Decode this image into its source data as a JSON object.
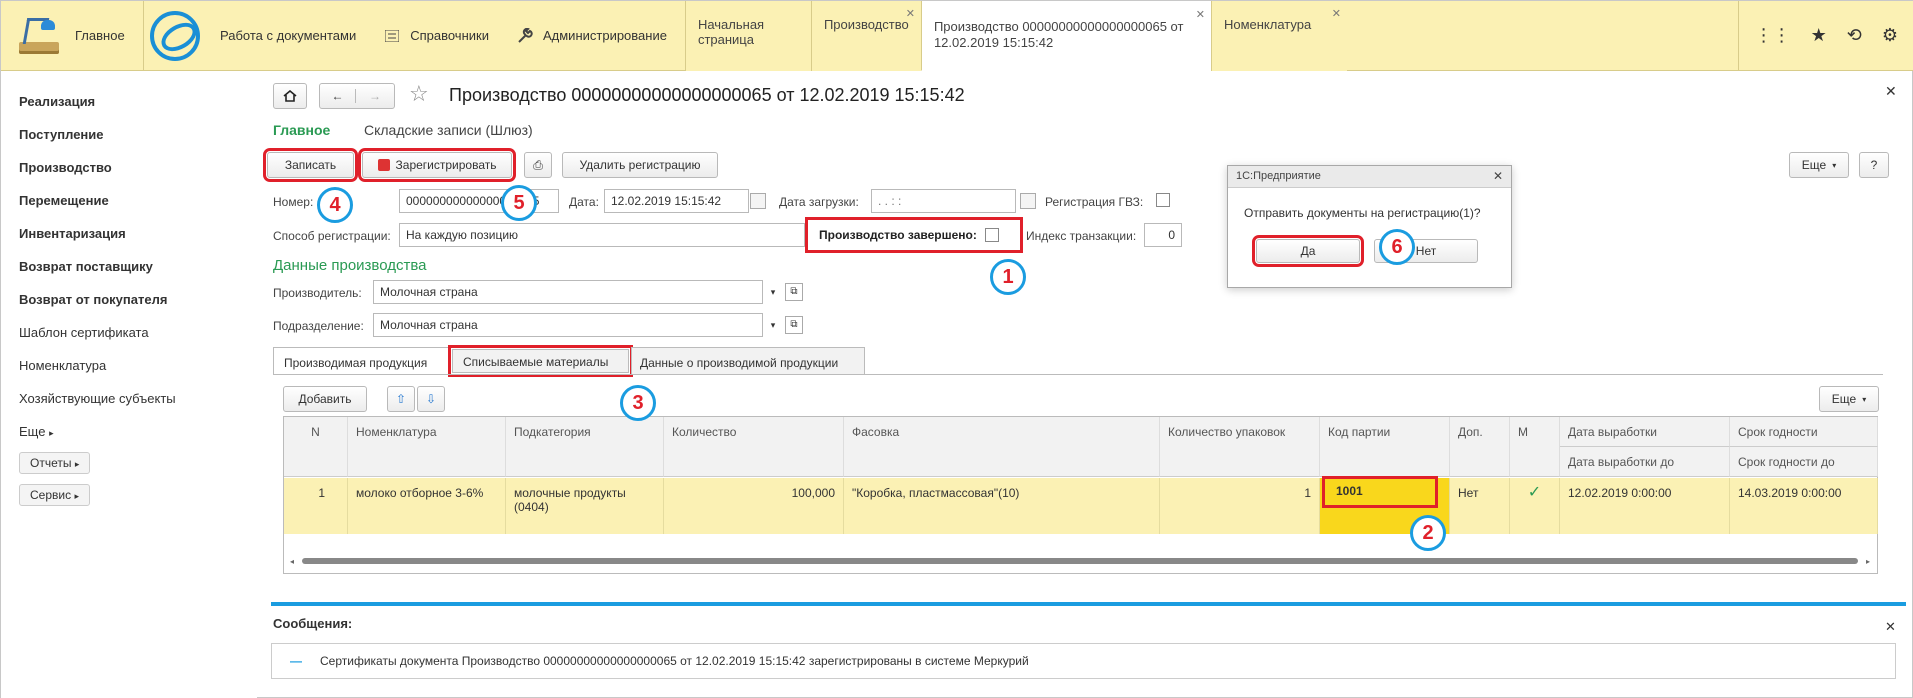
{
  "topbar": {
    "home_label": "Главное",
    "menu": [
      {
        "label": "Работа с документами"
      },
      {
        "label": "Справочники"
      },
      {
        "label": "Администрирование"
      }
    ],
    "tabs": [
      {
        "label": "Начальная страница"
      },
      {
        "label": "Производство"
      },
      {
        "label": "Производство 00000000000000000065 от",
        "label2": "12.02.2019 15:15:42"
      },
      {
        "label": "Номенклатура"
      }
    ]
  },
  "sidebar": {
    "items": [
      "Реализация",
      "Поступление",
      "Производство",
      "Перемещение",
      "Инвентаризация",
      "Возврат поставщику",
      "Возврат от покупателя",
      "Шаблон сертификата",
      "Номенклатура",
      "Хозяйствующие субъекты"
    ],
    "more": "Еще",
    "reports": "Отчеты",
    "service": "Сервис"
  },
  "doc": {
    "title": "Производство 00000000000000000065 от 12.02.2019 15:15:42",
    "nav_main": "Главное",
    "nav_wh": "Складские записи (Шлюз)",
    "btn_save": "Записать",
    "btn_register": "Зарегистрировать",
    "btn_delete_reg": "Удалить регистрацию",
    "btn_more": "Еще",
    "btn_help": "?",
    "number_label": "Номер:",
    "number_value": "00000000000000000065",
    "date_label": "Дата:",
    "date_value": "12.02.2019 15:15:42",
    "load_date_label": "Дата загрузки:",
    "load_date_value": " .  .       :  :",
    "gvz_label": "Регистрация ГВЗ:",
    "method_label": "Способ регистрации:",
    "method_value": "На каждую позицию",
    "done_label": "Производство завершено:",
    "tx_label": "Индекс транзакции:",
    "tx_value": "0",
    "section_title": "Данные производства",
    "producer_label": "Производитель:",
    "producer_value": "Молочная страна",
    "division_label": "Подразделение:",
    "division_value": "Молочная страна",
    "tabs": [
      "Производимая продукция",
      "Списываемые материалы",
      "Данные о производимой продукции"
    ],
    "btn_add": "Добавить"
  },
  "table": {
    "headers": [
      "N",
      "Номенклатура",
      "Подкатегория",
      "Количество",
      "Фасовка",
      "Количество упаковок",
      "Код партии",
      "Доп.",
      "М",
      "Дата выработки",
      "Срок годности"
    ],
    "headers2": {
      "prod_to": "Дата выработки до",
      "exp_to": "Срок годности до"
    },
    "row": {
      "n": "1",
      "nom": "молоко отборное 3-6%",
      "subcat": "молочные продукты (0404)",
      "qty": "100,000",
      "pack": "\"Коробка, пластмассовая\"(10)",
      "pack_qty": "1",
      "batch": "1001",
      "extra": "Нет",
      "m": "✓",
      "prod_date": "12.02.2019 0:00:00",
      "exp_date": "14.03.2019 0:00:00"
    }
  },
  "messages": {
    "title": "Сообщения:",
    "text": "Сертификаты документа Производство 00000000000000000065 от 12.02.2019 15:15:42 зарегистрированы в системе Меркурий"
  },
  "dialog": {
    "title": "1С:Предприятие",
    "question": "Отправить документы на регистрацию(1)?",
    "yes": "Да",
    "no": "Нет"
  },
  "badges": [
    "1",
    "2",
    "3",
    "4",
    "5",
    "6"
  ],
  "colors": {
    "accent_yellow": "#fbf1b4",
    "highlight_red": "#e0202a",
    "badge_blue": "#1a9ce0",
    "green_nav": "#2a9a53"
  }
}
